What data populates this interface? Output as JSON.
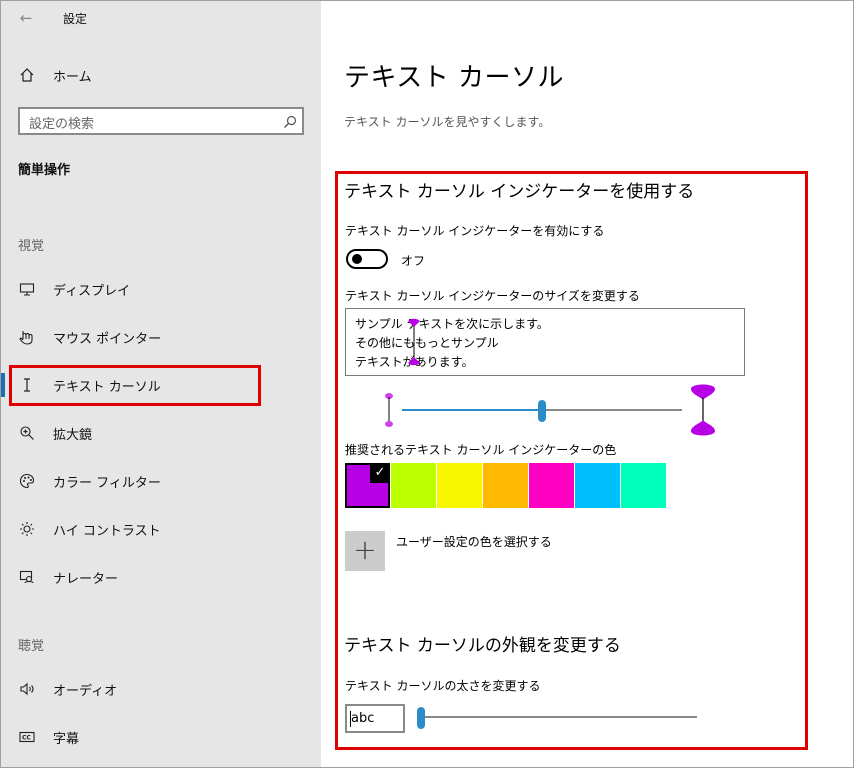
{
  "window": {
    "title": "設定",
    "back_glyph": "←"
  },
  "sidebar": {
    "home_label": "ホーム",
    "search_placeholder": "設定の検索",
    "category_title": "簡単操作",
    "sections": [
      {
        "heading": "視覚"
      },
      {
        "heading": "聴覚"
      }
    ],
    "items": [
      {
        "label": "ディスプレイ",
        "icon": "monitor-icon"
      },
      {
        "label": "マウス ポインター",
        "icon": "mouse-pointer-icon"
      },
      {
        "label": "テキスト カーソル",
        "icon": "text-cursor-icon",
        "selected": true
      },
      {
        "label": "拡大鏡",
        "icon": "magnifier-icon"
      },
      {
        "label": "カラー フィルター",
        "icon": "palette-icon"
      },
      {
        "label": "ハイ コントラスト",
        "icon": "brightness-icon"
      },
      {
        "label": "ナレーター",
        "icon": "narrator-icon"
      },
      {
        "label": "オーディオ",
        "icon": "speaker-icon"
      },
      {
        "label": "字幕",
        "icon": "captions-icon"
      }
    ]
  },
  "main": {
    "page_title": "テキスト カーソル",
    "page_subtitle": "テキスト カーソルを見やすくします。",
    "indicator": {
      "heading": "テキスト カーソル インジケーターを使用する",
      "enable_label": "テキスト カーソル インジケーターを有効にする",
      "toggle_state": "オフ",
      "toggle_on": false,
      "size_label": "テキスト カーソル インジケーターのサイズを変更する",
      "sample_lines": [
        "サンプル テキストを次に示します。",
        "その他にももっとサンプル",
        "テキストがあります。"
      ],
      "size_value": 0.5,
      "colors_label": "推奨されるテキスト カーソル インジケーターの色",
      "colors": [
        "#b800e6",
        "#bbff00",
        "#f7f700",
        "#ffb900",
        "#ff00c3",
        "#00bfff",
        "#00ffbb"
      ],
      "selected_color_index": 0,
      "check_glyph": "✓",
      "custom_color_label": "ユーザー設定の色を選択する",
      "plus_glyph": "+"
    },
    "appearance": {
      "heading": "テキスト カーソルの外観を変更する",
      "thickness_label": "テキスト カーソルの太さを変更する",
      "preview_text": "abc",
      "thickness_value": 0.0
    }
  },
  "colors": {
    "accent": "#2a8dc9",
    "highlight": "#e00000",
    "indicator": "#b800e6"
  }
}
